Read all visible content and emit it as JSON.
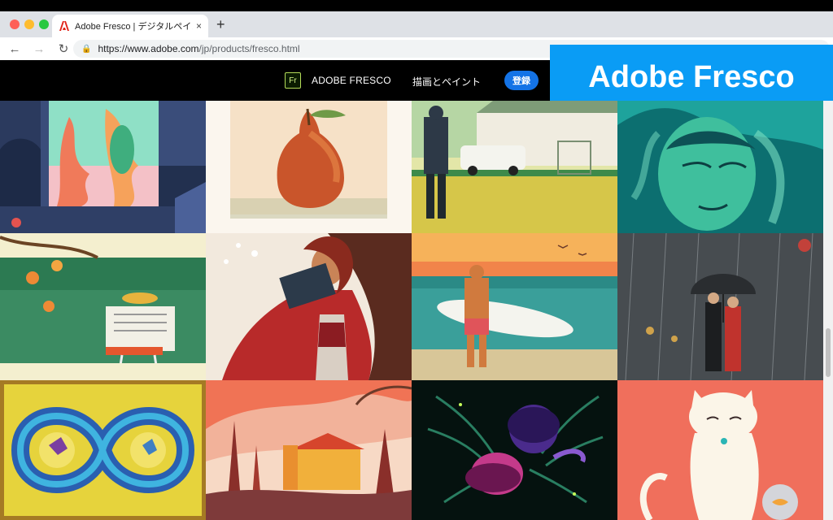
{
  "browser": {
    "tab_title": "Adobe Fresco | デジタルペインテ",
    "tab_close": "×",
    "new_tab": "+",
    "url_host": "https://www.adobe.com",
    "url_path": "/jp/products/fresco.html",
    "back": "←",
    "forward": "→",
    "reload": "↻"
  },
  "site_nav": {
    "logo_text": "Fr",
    "product_name": "ADOBE FRESCO",
    "link_paint": "描画とペイント",
    "signup": "登録"
  },
  "overlay_title": "Adobe Fresco",
  "colors": {
    "accent": "#1473e6",
    "overlay": "#0a9cf5",
    "fresco_green": "#b5dc5a"
  },
  "gallery": [
    {
      "name": "abstract-window-art"
    },
    {
      "name": "pear-art"
    },
    {
      "name": "street-scene-art"
    },
    {
      "name": "teal-portrait-art"
    },
    {
      "name": "newspaper-reader-art"
    },
    {
      "name": "book-woman-art"
    },
    {
      "name": "surfer-sunset-art"
    },
    {
      "name": "rain-umbrella-art"
    },
    {
      "name": "dragon-infinity-art"
    },
    {
      "name": "tuscany-landscape-art"
    },
    {
      "name": "palm-faces-art"
    },
    {
      "name": "cat-fishbowl-art"
    }
  ]
}
